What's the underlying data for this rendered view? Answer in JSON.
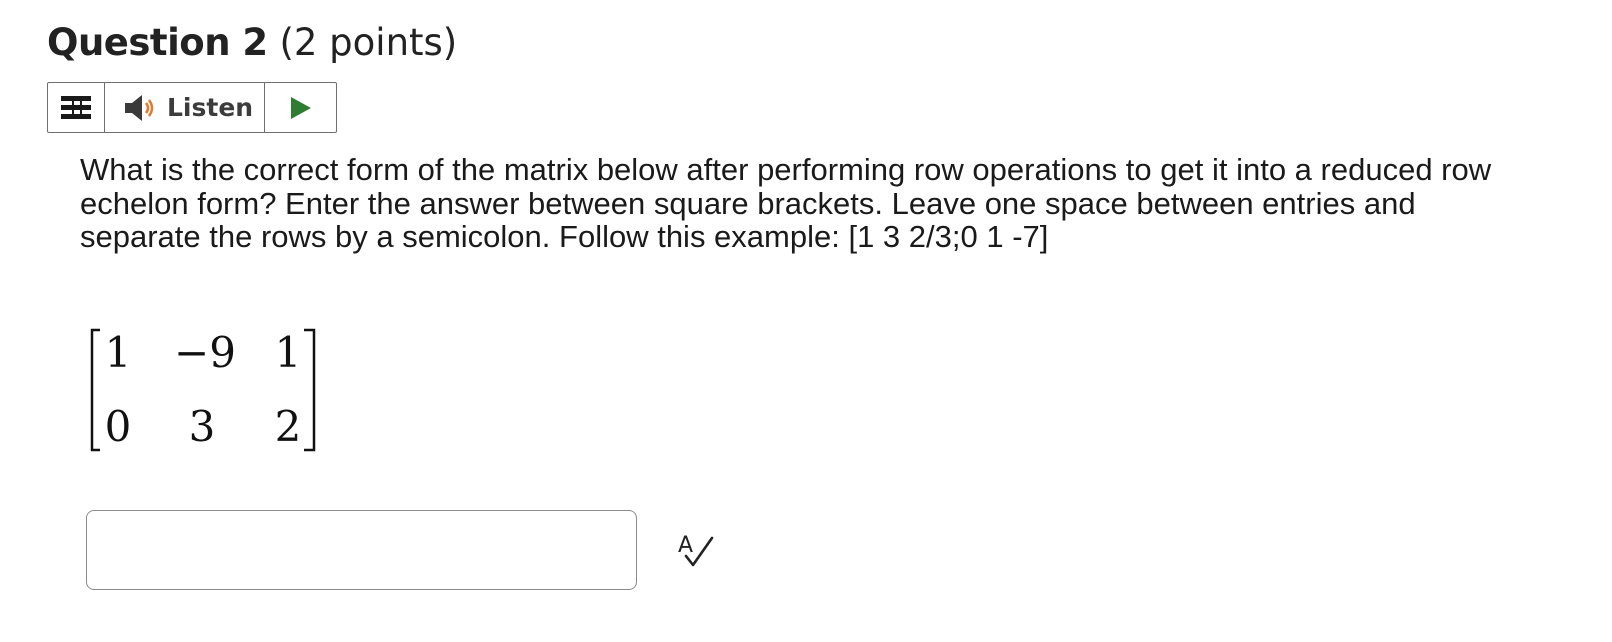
{
  "question": {
    "title": "Question 2",
    "points": "(2 points)"
  },
  "listen_bar": {
    "menu_icon": "hamburger-menu-icon",
    "speaker_icon": "speaker-icon",
    "listen_label": "Listen",
    "play_icon": "play-icon",
    "play_color": "#2e7d32"
  },
  "prompt": {
    "text": "What is the correct form of the matrix below after performing row operations to get it into a reduced row echelon form? Enter the answer between square brackets. Leave one space between entries and separate the rows by a semicolon. Follow this example: [1 3 2/3;0 1 -7]"
  },
  "matrix": {
    "rows": [
      [
        "1",
        "−9",
        "1"
      ],
      [
        "0",
        "3",
        "2"
      ]
    ]
  },
  "answer": {
    "value": "",
    "placeholder": ""
  },
  "spellcheck": {
    "icon": "spell-check-icon"
  }
}
